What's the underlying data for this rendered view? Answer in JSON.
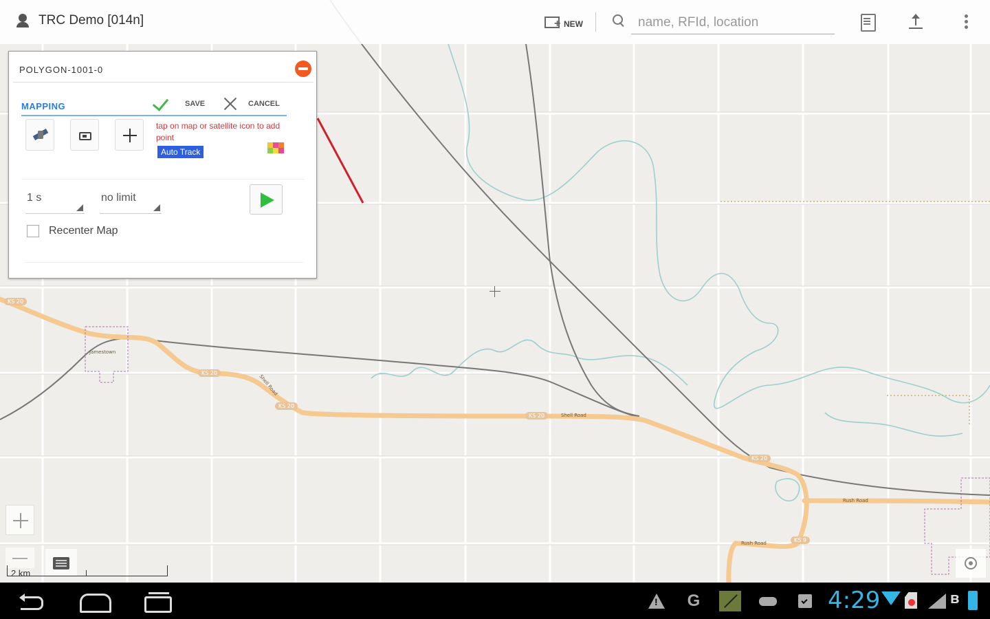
{
  "app": {
    "title": "TRC Demo [014n]"
  },
  "actionbar": {
    "new_label": "NEW",
    "search_placeholder": "name, RFId, location",
    "icons": [
      "user-icon",
      "new-item-icon",
      "search-icon",
      "list-icon",
      "upload-icon",
      "overflow-menu-icon"
    ]
  },
  "panel": {
    "title": "POLYGON-1001-0",
    "mode_tab": "MAPPING",
    "save_label": "SAVE",
    "cancel_label": "CANCEL",
    "hint": "tap on map or satellite icon to add point",
    "auto_track_label": "Auto Track",
    "interval_value": "1 s",
    "limit_value": "no limit",
    "recenter_label": "Recenter Map",
    "recenter_checked": false,
    "tools": [
      "satellite-icon",
      "record-icon",
      "move-icon"
    ]
  },
  "map": {
    "scale_label": "2 km",
    "road_labels": [
      "KS 20",
      "KS 20",
      "KS 20",
      "KS 20",
      "KS 20",
      "KS 9"
    ],
    "street_labels": [
      "Shell Road",
      "Shell Road",
      "Rush Road",
      "Rush Road"
    ],
    "town_label": "Jamestown",
    "controls": [
      "zoom-in-button",
      "zoom-out-button",
      "layers-button",
      "locate-button"
    ]
  },
  "statusbar": {
    "time": "4:29",
    "icons": [
      "warning-icon",
      "g-icon",
      "notes-icon",
      "gamepad-icon",
      "clipboard-icon",
      "wifi-icon",
      "sd-card-icon",
      "signal-icon",
      "bluetooth-icon",
      "battery-icon"
    ]
  },
  "colors": {
    "accent": "#33b5e5",
    "mapping_blue": "#2d7ce0",
    "hint_red": "#e0343a",
    "play_green": "#2fbf3e",
    "road_orange": "#f5c990",
    "river": "#9ccfcf",
    "polygon_line": "#d0202a"
  }
}
